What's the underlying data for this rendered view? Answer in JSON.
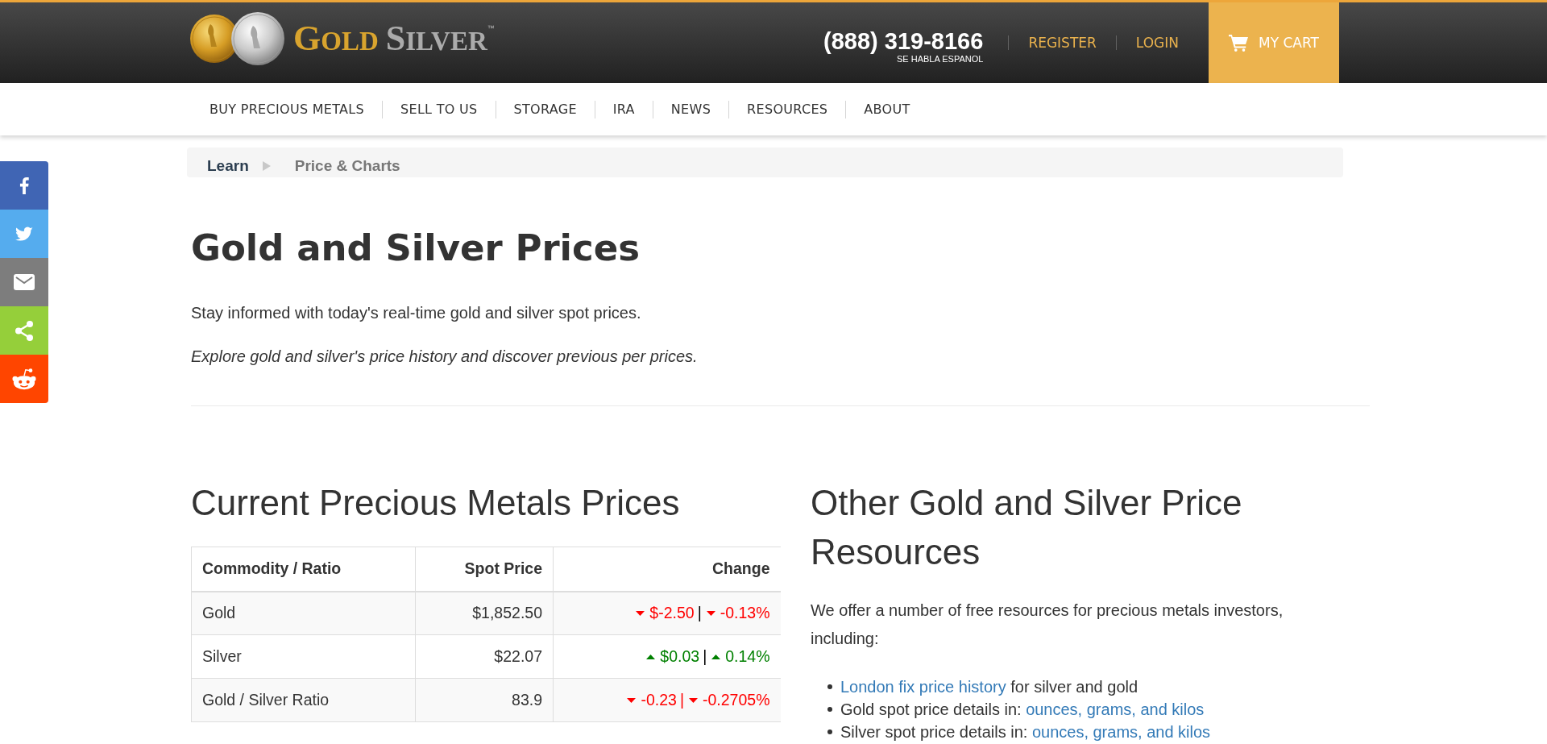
{
  "share_buttons": [
    {
      "kind": "facebook",
      "color": "#4065b4"
    },
    {
      "kind": "twitter",
      "color": "#55acee"
    },
    {
      "kind": "email",
      "color": "#7d7d7d"
    },
    {
      "kind": "share",
      "color": "#95cf3a"
    },
    {
      "kind": "reddit",
      "color": "#ff4500"
    }
  ],
  "header": {
    "logo": {
      "word_1": "GOLD",
      "word_2": "SILVER",
      "trademark": "™"
    },
    "phone": "(888) 319-8166",
    "phone_note": "SE HABLA ESPANOL",
    "account_links": [
      "REGISTER",
      "LOGIN"
    ],
    "cart": "MY CART"
  },
  "nav": [
    "BUY PRECIOUS METALS",
    "SELL TO US",
    "STORAGE",
    "IRA",
    "NEWS",
    "RESOURCES",
    "ABOUT"
  ],
  "breadcrumb": [
    {
      "label": "Learn",
      "current": false
    },
    {
      "label": "Price & Charts",
      "current": true
    }
  ],
  "page": {
    "title": "Gold and Silver Prices",
    "intro": "Stay informed with today's real-time gold and silver spot prices.",
    "note": "Explore gold and silver's price history and discover previous per prices."
  },
  "prices": {
    "heading": "Current Precious Metals Prices",
    "table": {
      "columns": [
        "Commodity / Ratio",
        "Spot Price",
        "Change"
      ],
      "rows": [
        {
          "commodity": "Gold",
          "spot_price": "$1,852.50",
          "change": {
            "amount": {
              "rising": false,
              "text": "$-2.50"
            },
            "separator": {
              "text": "|",
              "color": "#000000"
            },
            "percent": {
              "rising": false,
              "text": "-0.13%"
            }
          }
        },
        {
          "commodity": "Silver",
          "spot_price": "$22.07",
          "change": {
            "amount": {
              "rising": true,
              "text": "$0.03"
            },
            "separator": {
              "text": "|",
              "color": "#000000"
            },
            "percent": {
              "rising": true,
              "text": "0.14%"
            }
          }
        },
        {
          "commodity": "Gold / Silver Ratio",
          "spot_price": "83.9",
          "change": {
            "amount": {
              "rising": false,
              "text": "-0.23"
            },
            "separator": {
              "text": "|",
              "color": "#ff0000"
            },
            "percent": {
              "rising": false,
              "text": "-0.2705%"
            }
          }
        }
      ]
    }
  },
  "resources": {
    "heading": "Other Gold and Silver Price Resources",
    "intro": "We offer a number of free resources for precious metals investors, including:",
    "items": [
      {
        "parts": [
          {
            "kind": "link",
            "text": "London fix price history"
          },
          {
            "kind": "text",
            "text": "for silver and gold"
          }
        ]
      },
      {
        "parts": [
          {
            "kind": "text",
            "text": "Gold spot price details in:"
          },
          {
            "kind": "link",
            "text": "ounces, grams, and kilos"
          }
        ]
      },
      {
        "parts": [
          {
            "kind": "text",
            "text": "Silver spot price details in:"
          },
          {
            "kind": "link",
            "text": "ounces, grams, and kilos"
          }
        ]
      }
    ]
  }
}
